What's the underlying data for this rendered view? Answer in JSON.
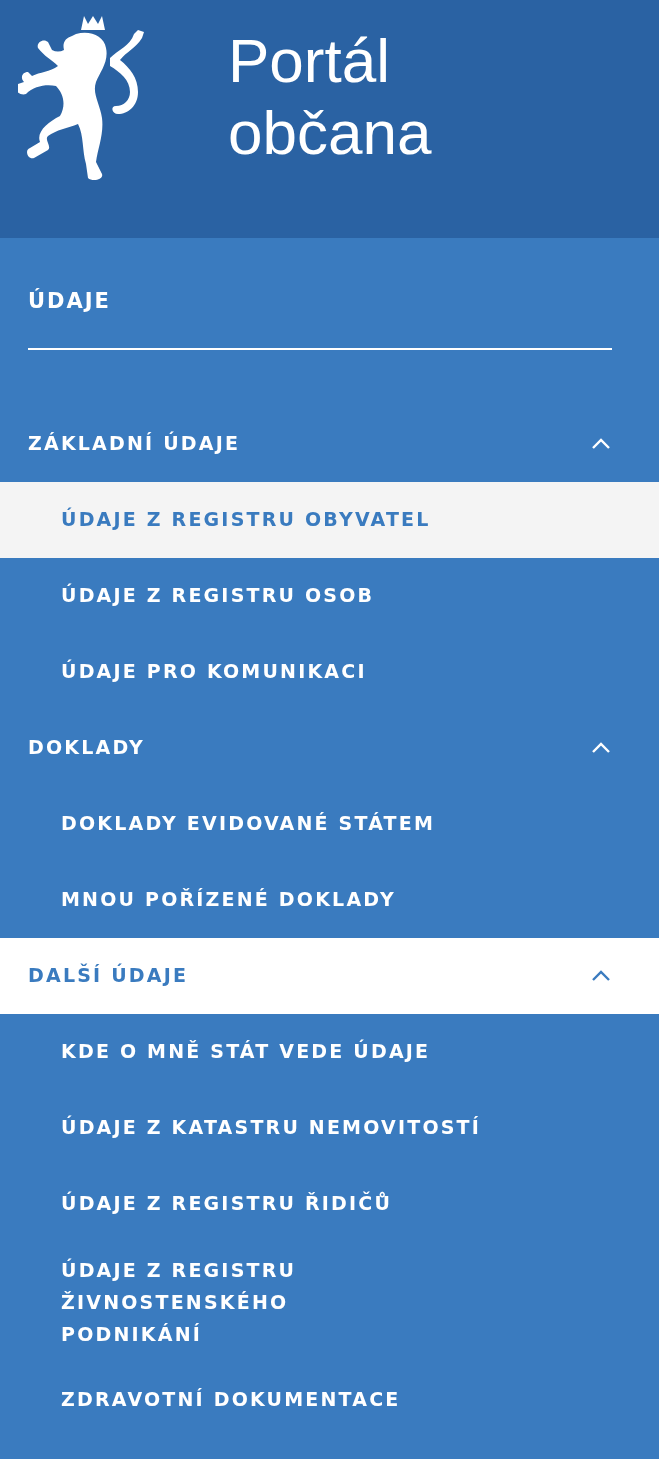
{
  "header": {
    "title_lines": [
      "Portál",
      "občana"
    ]
  },
  "section": {
    "title": "ÚDAJE"
  },
  "groups": [
    {
      "label": "ZÁKLADNÍ ÚDAJE",
      "expanded": true,
      "selected": false,
      "children": [
        {
          "label": "ÚDAJE Z REGISTRU OBYVATEL",
          "selected": true
        },
        {
          "label": "ÚDAJE Z REGISTRU OSOB",
          "selected": false
        },
        {
          "label": "ÚDAJE PRO KOMUNIKACI",
          "selected": false
        }
      ]
    },
    {
      "label": "DOKLADY",
      "expanded": true,
      "selected": false,
      "children": [
        {
          "label": "DOKLADY EVIDOVANÉ STÁTEM",
          "selected": false
        },
        {
          "label": "MNOU POŘÍZENÉ DOKLADY",
          "selected": false
        }
      ]
    },
    {
      "label": "DALŠÍ ÚDAJE",
      "expanded": true,
      "selected": true,
      "children": [
        {
          "label": "KDE O MNĚ STÁT VEDE ÚDAJE",
          "selected": false
        },
        {
          "label": "ÚDAJE Z KATASTRU NEMOVITOSTÍ",
          "selected": false
        },
        {
          "label": "ÚDAJE Z REGISTRU ŘIDIČŮ",
          "selected": false
        },
        {
          "label": "ÚDAJE Z REGISTRU ŽIVNOSTENSKÉHO PODNIKÁNÍ",
          "selected": false
        },
        {
          "label": "ZDRAVOTNÍ DOKUMENTACE",
          "selected": false
        }
      ]
    }
  ]
}
